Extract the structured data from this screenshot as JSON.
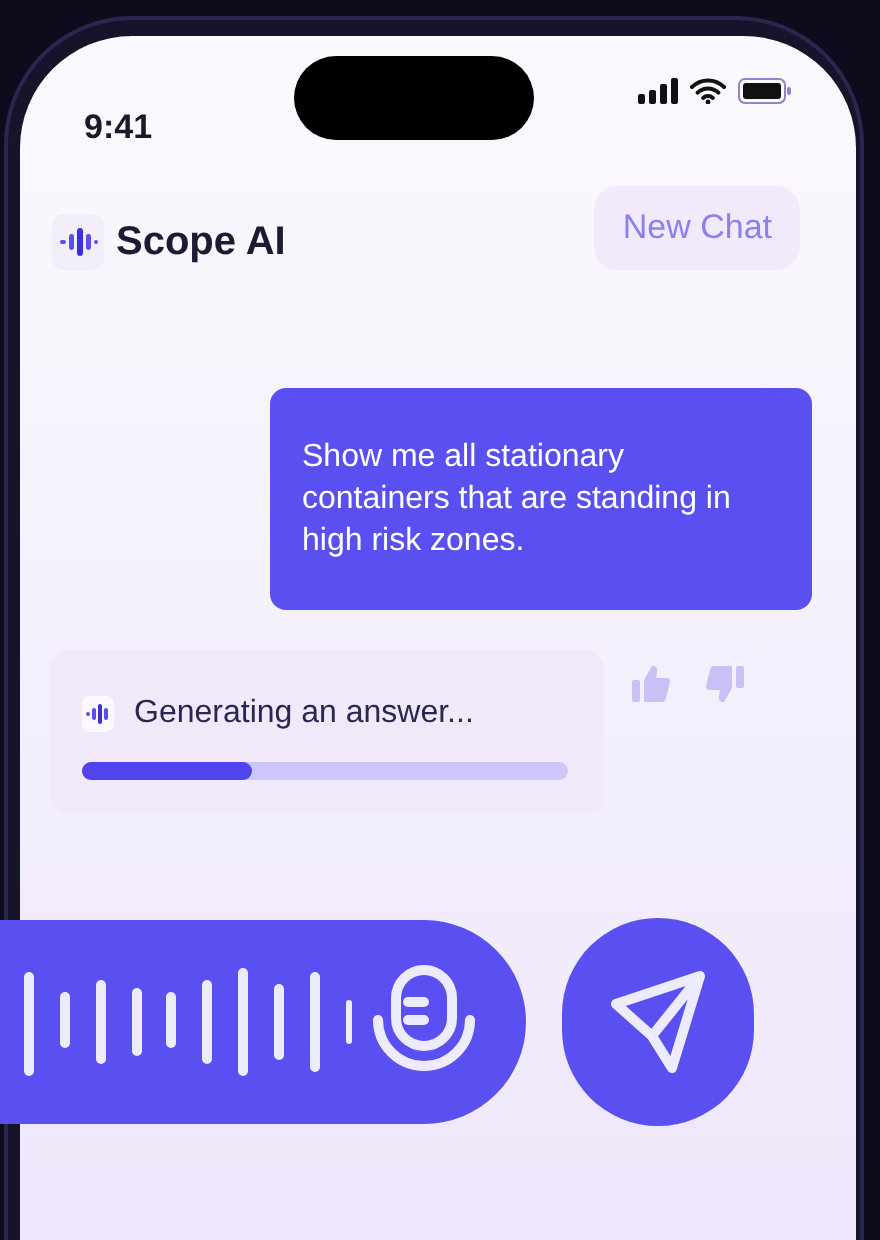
{
  "status_bar": {
    "time": "9:41"
  },
  "header": {
    "title": "Scope AI",
    "button": "New Chat"
  },
  "messages": [
    {
      "kind": "user",
      "text": "Show me all stationary containers that are standing in high risk zones."
    },
    {
      "kind": "bot",
      "text": "Generating an answer...",
      "level": 0.35
    }
  ]
}
